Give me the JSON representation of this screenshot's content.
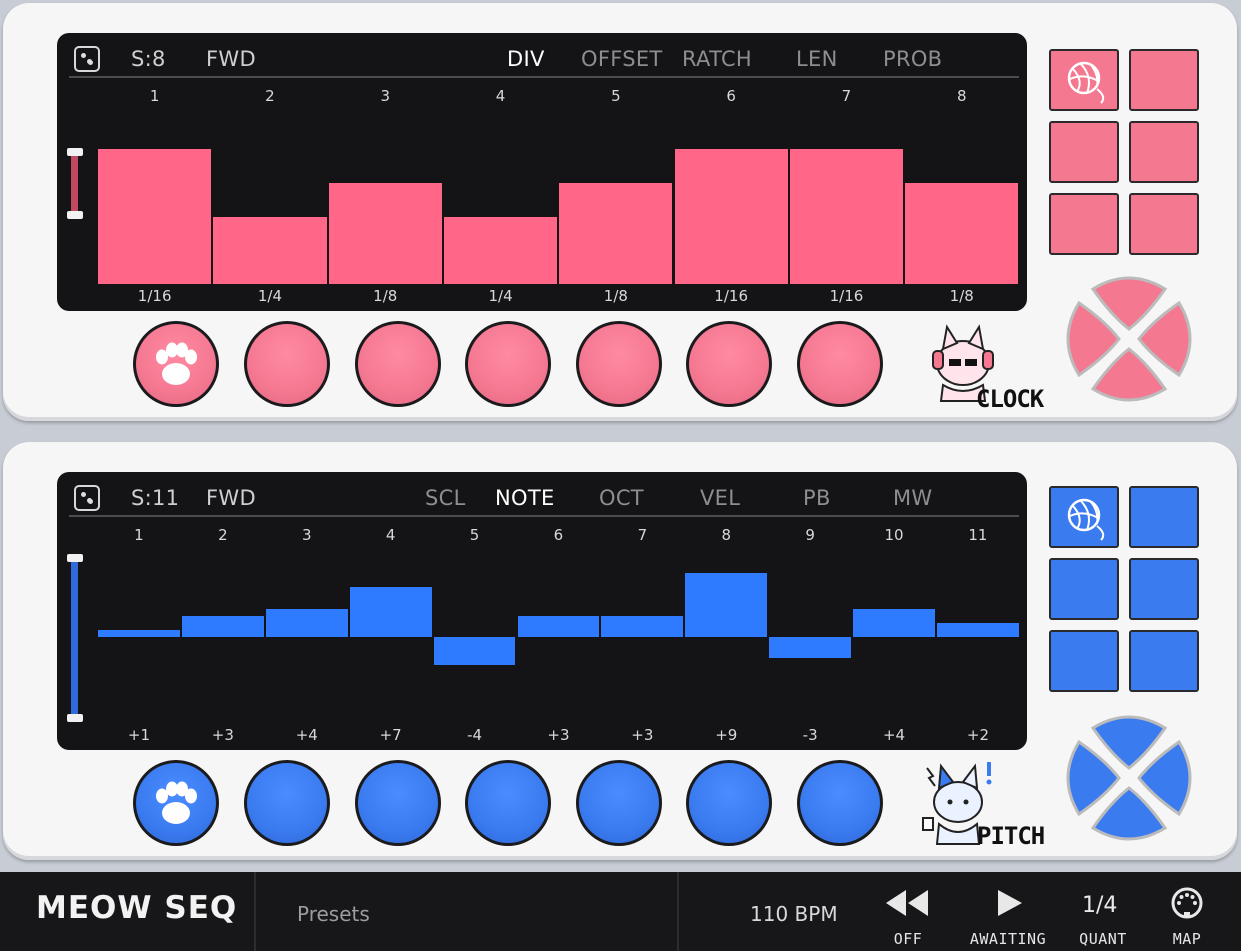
{
  "colors": {
    "pink": "#f57891",
    "pink_bar": "#ff6688",
    "blue": "#3a7bf0",
    "blue_bar": "#2f7bff",
    "screen": "#141416"
  },
  "clock": {
    "steps_label": "S:8",
    "direction": "FWD",
    "tabs": [
      {
        "label": "DIV",
        "active": true
      },
      {
        "label": "OFFSET",
        "active": false
      },
      {
        "label": "RATCH",
        "active": false
      },
      {
        "label": "LEN",
        "active": false
      },
      {
        "label": "PROB",
        "active": false
      }
    ],
    "step_numbers": [
      "1",
      "2",
      "3",
      "4",
      "5",
      "6",
      "7",
      "8"
    ],
    "step_values": [
      "1/16",
      "1/4",
      "1/8",
      "1/4",
      "1/8",
      "1/16",
      "1/16",
      "1/8"
    ],
    "bar_levels": [
      4,
      2,
      3,
      2,
      3,
      4,
      4,
      3
    ],
    "bar_level_max": 4,
    "mascot_label": "CLOCK",
    "icons": {
      "dice": "dice-icon",
      "paw": "paw-icon",
      "yarn": "yarn-ball-icon"
    }
  },
  "pitch": {
    "steps_label": "S:11",
    "direction": "FWD",
    "tabs": [
      {
        "label": "SCL",
        "active": false
      },
      {
        "label": "NOTE",
        "active": true
      },
      {
        "label": "OCT",
        "active": false
      },
      {
        "label": "VEL",
        "active": false
      },
      {
        "label": "PB",
        "active": false
      },
      {
        "label": "MW",
        "active": false
      }
    ],
    "step_numbers": [
      "1",
      "2",
      "3",
      "4",
      "5",
      "6",
      "7",
      "8",
      "9",
      "10",
      "11"
    ],
    "step_values": [
      "+1",
      "+3",
      "+4",
      "+7",
      "-4",
      "+3",
      "+3",
      "+9",
      "-3",
      "+4",
      "+2"
    ],
    "note_offsets": [
      1,
      3,
      4,
      7,
      -4,
      3,
      3,
      9,
      -3,
      4,
      2
    ],
    "mascot_label": "PITCH",
    "icons": {
      "dice": "dice-icon",
      "paw": "paw-icon",
      "yarn": "yarn-ball-icon"
    }
  },
  "footer": {
    "logo": "MEOW SEQ",
    "presets": "Presets",
    "bpm": "110 BPM",
    "rewind_label": "OFF",
    "play_label": "AWAITING",
    "quant_value": "1/4",
    "quant_label": "QUANT",
    "map_label": "MAP"
  }
}
